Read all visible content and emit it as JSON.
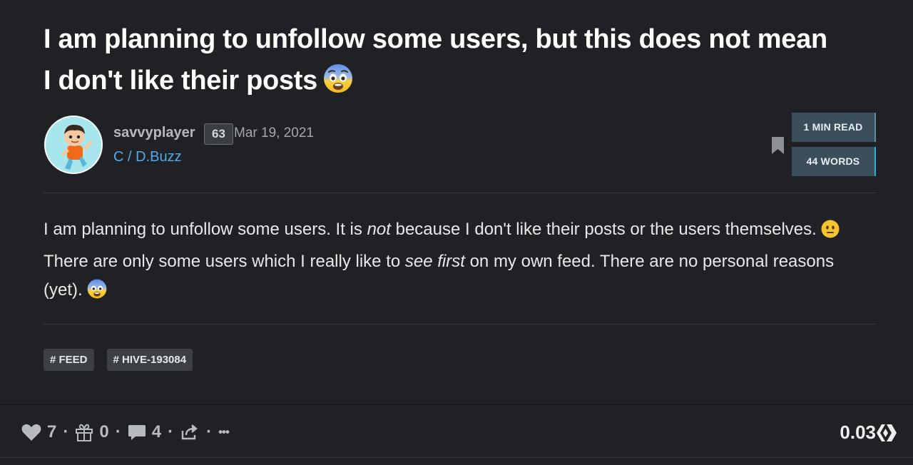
{
  "post": {
    "title": "I am planning to unfollow some users, but this does not mean I don't like their posts",
    "title_emoji": "fearful-face",
    "author": "savvyplayer",
    "reputation": "63",
    "date": "Mar 19, 2021",
    "community": "C / D.Buzz",
    "read_time": "1 MIN READ",
    "word_count": "44 WORDS"
  },
  "body": {
    "part1": "I am planning to unfollow some users. It is ",
    "em1": "not",
    "part2": " because I don't like their posts or the users themselves.",
    "emoji1": "neutral-face",
    "part3": "There are only some users which I really like to ",
    "em2": "see first",
    "part4": " on my own feed. There are no personal reasons (yet).",
    "emoji2": "fearful-face"
  },
  "tags": [
    "# FEED",
    "# HIVE-193084"
  ],
  "footer": {
    "votes": "7",
    "gifts": "0",
    "comments": "4",
    "separator": "·",
    "more": "•••",
    "payout": "0.03"
  },
  "colors": {
    "background": "#1f2125",
    "link": "#55a9e8",
    "read_box": "#3b4e5c",
    "words_accent": "#1fb5d6",
    "tag_bg": "#3c3f44"
  },
  "icons": [
    "bookmark-icon",
    "heart-icon",
    "gift-icon",
    "comment-icon",
    "share-icon",
    "more-icon",
    "hive-logo-icon"
  ]
}
